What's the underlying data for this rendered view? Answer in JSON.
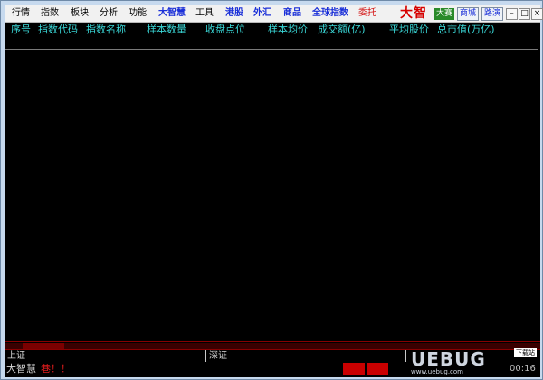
{
  "menu": [
    "行情",
    "指数",
    "板块",
    "分析",
    "功能",
    "大智慧",
    "工具",
    "港股",
    "外汇",
    "商品",
    "全球指数",
    "委托"
  ],
  "logo": {
    "text": "大智",
    "badge": "大赛"
  },
  "toolbar": {
    "mall": "商城",
    "news": "路演"
  },
  "window_buttons": {
    "minimize": "–",
    "restore": "□",
    "close": "×"
  },
  "table": {
    "columns": [
      "序号",
      "指数代码",
      "指数名称",
      "样本数量",
      "收盘点位",
      "样本均价",
      "成交额(亿)",
      "平均股价",
      "总市值(万亿)"
    ]
  },
  "status": {
    "shanghai": "上证",
    "shenzhen": "深证",
    "ticker_label": "大智慧",
    "ticker_text": "巷！！"
  },
  "watermark": {
    "text": "UEBUG",
    "sub": "www.uebug.com",
    "download": "下载站",
    "time": "00:16"
  },
  "colors": {
    "header_text": "#3ad8d8",
    "background": "#000000",
    "accent_red": "#c90000"
  }
}
